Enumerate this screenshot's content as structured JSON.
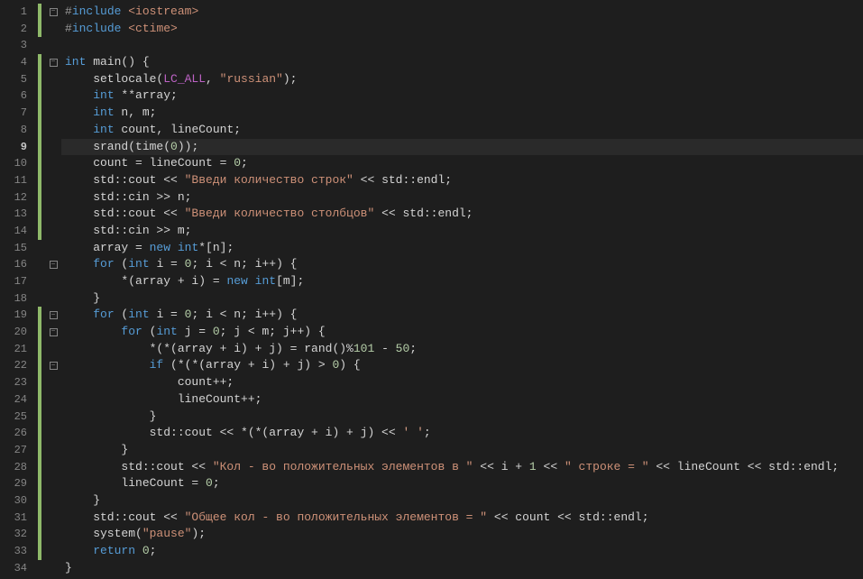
{
  "editor": {
    "current_line": 9,
    "lines": [
      {
        "n": 1,
        "marker": "green",
        "fold": "-",
        "tokens": [
          [
            "pp",
            "#"
          ],
          [
            "kw",
            "include"
          ],
          [
            "id",
            " "
          ],
          [
            "ang",
            "<iostream>"
          ]
        ]
      },
      {
        "n": 2,
        "marker": "green",
        "fold": "",
        "tokens": [
          [
            "pp",
            "#"
          ],
          [
            "kw",
            "include"
          ],
          [
            "id",
            " "
          ],
          [
            "ang",
            "<ctime>"
          ]
        ]
      },
      {
        "n": 3,
        "marker": "",
        "fold": "",
        "tokens": []
      },
      {
        "n": 4,
        "marker": "green",
        "fold": "-",
        "tokens": [
          [
            "kw",
            "int"
          ],
          [
            "id",
            " main() {"
          ]
        ]
      },
      {
        "n": 5,
        "marker": "green",
        "fold": "",
        "tokens": [
          [
            "id",
            "    setlocale("
          ],
          [
            "mac",
            "LC_ALL"
          ],
          [
            "id",
            ", "
          ],
          [
            "str",
            "\"russian\""
          ],
          [
            "id",
            ");"
          ]
        ]
      },
      {
        "n": 6,
        "marker": "green",
        "fold": "",
        "tokens": [
          [
            "id",
            "    "
          ],
          [
            "kw",
            "int"
          ],
          [
            "id",
            " **array;"
          ]
        ]
      },
      {
        "n": 7,
        "marker": "green",
        "fold": "",
        "tokens": [
          [
            "id",
            "    "
          ],
          [
            "kw",
            "int"
          ],
          [
            "id",
            " n, m;"
          ]
        ]
      },
      {
        "n": 8,
        "marker": "green",
        "fold": "",
        "tokens": [
          [
            "id",
            "    "
          ],
          [
            "kw",
            "int"
          ],
          [
            "id",
            " count, lineCount;"
          ]
        ]
      },
      {
        "n": 9,
        "marker": "green",
        "fold": "",
        "tokens": [
          [
            "id",
            "    srand(time("
          ],
          [
            "num",
            "0"
          ],
          [
            "id",
            "));"
          ]
        ]
      },
      {
        "n": 10,
        "marker": "green",
        "fold": "",
        "tokens": [
          [
            "id",
            "    count = lineCount = "
          ],
          [
            "num",
            "0"
          ],
          [
            "id",
            ";"
          ]
        ]
      },
      {
        "n": 11,
        "marker": "green",
        "fold": "",
        "tokens": [
          [
            "id",
            "    std::cout << "
          ],
          [
            "str",
            "\"Введи количество строк\""
          ],
          [
            "id",
            " << std::endl;"
          ]
        ]
      },
      {
        "n": 12,
        "marker": "green",
        "fold": "",
        "tokens": [
          [
            "id",
            "    std::cin >> n;"
          ]
        ]
      },
      {
        "n": 13,
        "marker": "green",
        "fold": "",
        "tokens": [
          [
            "id",
            "    std::cout << "
          ],
          [
            "str",
            "\"Введи количество столбцов\""
          ],
          [
            "id",
            " << std::endl;"
          ]
        ]
      },
      {
        "n": 14,
        "marker": "green",
        "fold": "",
        "tokens": [
          [
            "id",
            "    std::cin >> m;"
          ]
        ]
      },
      {
        "n": 15,
        "marker": "",
        "fold": "",
        "tokens": [
          [
            "id",
            "    array = "
          ],
          [
            "kw",
            "new"
          ],
          [
            "id",
            " "
          ],
          [
            "kw",
            "int"
          ],
          [
            "id",
            "*[n];"
          ]
        ]
      },
      {
        "n": 16,
        "marker": "",
        "fold": "-",
        "tokens": [
          [
            "id",
            "    "
          ],
          [
            "kw",
            "for"
          ],
          [
            "id",
            " ("
          ],
          [
            "kw",
            "int"
          ],
          [
            "id",
            " i = "
          ],
          [
            "num",
            "0"
          ],
          [
            "id",
            "; i < n; i++) {"
          ]
        ]
      },
      {
        "n": 17,
        "marker": "",
        "fold": "",
        "tokens": [
          [
            "id",
            "        *(array + i) = "
          ],
          [
            "kw",
            "new"
          ],
          [
            "id",
            " "
          ],
          [
            "kw",
            "int"
          ],
          [
            "id",
            "[m];"
          ]
        ]
      },
      {
        "n": 18,
        "marker": "",
        "fold": "",
        "tokens": [
          [
            "id",
            "    }"
          ]
        ]
      },
      {
        "n": 19,
        "marker": "green",
        "fold": "-",
        "tokens": [
          [
            "id",
            "    "
          ],
          [
            "kw",
            "for"
          ],
          [
            "id",
            " ("
          ],
          [
            "kw",
            "int"
          ],
          [
            "id",
            " i = "
          ],
          [
            "num",
            "0"
          ],
          [
            "id",
            "; i < n; i++) {"
          ]
        ]
      },
      {
        "n": 20,
        "marker": "green",
        "fold": "-",
        "tokens": [
          [
            "id",
            "        "
          ],
          [
            "kw",
            "for"
          ],
          [
            "id",
            " ("
          ],
          [
            "kw",
            "int"
          ],
          [
            "id",
            " j = "
          ],
          [
            "num",
            "0"
          ],
          [
            "id",
            "; j < m; j++) {"
          ]
        ]
      },
      {
        "n": 21,
        "marker": "green",
        "fold": "",
        "tokens": [
          [
            "id",
            "            *(*(array + i) + j) = rand()%"
          ],
          [
            "num",
            "101"
          ],
          [
            "id",
            " - "
          ],
          [
            "num",
            "50"
          ],
          [
            "id",
            ";"
          ]
        ]
      },
      {
        "n": 22,
        "marker": "green",
        "fold": "-",
        "tokens": [
          [
            "id",
            "            "
          ],
          [
            "kw",
            "if"
          ],
          [
            "id",
            " (*(*(array + i) + j) > "
          ],
          [
            "num",
            "0"
          ],
          [
            "id",
            ") {"
          ]
        ]
      },
      {
        "n": 23,
        "marker": "green",
        "fold": "",
        "tokens": [
          [
            "id",
            "                count++;"
          ]
        ]
      },
      {
        "n": 24,
        "marker": "green",
        "fold": "",
        "tokens": [
          [
            "id",
            "                lineCount++;"
          ]
        ]
      },
      {
        "n": 25,
        "marker": "green",
        "fold": "",
        "tokens": [
          [
            "id",
            "            }"
          ]
        ]
      },
      {
        "n": 26,
        "marker": "green",
        "fold": "",
        "tokens": [
          [
            "id",
            "            std::cout << *(*(array + i) + j) << "
          ],
          [
            "chr",
            "' '"
          ],
          [
            "id",
            ";"
          ]
        ]
      },
      {
        "n": 27,
        "marker": "green",
        "fold": "",
        "tokens": [
          [
            "id",
            "        }"
          ]
        ]
      },
      {
        "n": 28,
        "marker": "green",
        "fold": "",
        "tokens": [
          [
            "id",
            "        std::cout << "
          ],
          [
            "str",
            "\"Кол - во положительных элементов в \""
          ],
          [
            "id",
            " << i + "
          ],
          [
            "num",
            "1"
          ],
          [
            "id",
            " << "
          ],
          [
            "str",
            "\" строке = \""
          ],
          [
            "id",
            " << lineCount << std::endl;"
          ]
        ]
      },
      {
        "n": 29,
        "marker": "green",
        "fold": "",
        "tokens": [
          [
            "id",
            "        lineCount = "
          ],
          [
            "num",
            "0"
          ],
          [
            "id",
            ";"
          ]
        ]
      },
      {
        "n": 30,
        "marker": "green",
        "fold": "",
        "tokens": [
          [
            "id",
            "    }"
          ]
        ]
      },
      {
        "n": 31,
        "marker": "green",
        "fold": "",
        "tokens": [
          [
            "id",
            "    std::cout << "
          ],
          [
            "str",
            "\"Общее кол - во положительных элементов = \""
          ],
          [
            "id",
            " << count << std::endl;"
          ]
        ]
      },
      {
        "n": 32,
        "marker": "green",
        "fold": "",
        "tokens": [
          [
            "id",
            "    system("
          ],
          [
            "str",
            "\"pause\""
          ],
          [
            "id",
            ");"
          ]
        ]
      },
      {
        "n": 33,
        "marker": "green",
        "fold": "",
        "tokens": [
          [
            "id",
            "    "
          ],
          [
            "kw",
            "return"
          ],
          [
            "id",
            " "
          ],
          [
            "num",
            "0"
          ],
          [
            "id",
            ";"
          ]
        ]
      },
      {
        "n": 34,
        "marker": "",
        "fold": "",
        "tokens": [
          [
            "id",
            "}"
          ]
        ]
      }
    ]
  }
}
